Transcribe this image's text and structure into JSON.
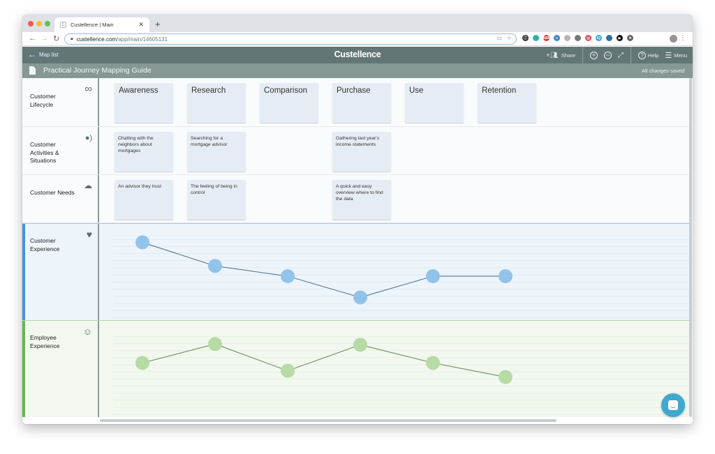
{
  "browser": {
    "tab_title": "Custellence | Main",
    "tab_favicon": "C",
    "url_domain": "custellence.com",
    "url_path": "/app/main/14605131",
    "extensions": [
      {
        "name": "1password-icon",
        "color": "#333333",
        "glyph": "ⓘ"
      },
      {
        "name": "teal-extension-icon",
        "color": "#2bb3a8",
        "glyph": ""
      },
      {
        "name": "adblock-icon",
        "color": "#d63a3a",
        "glyph": "ABP"
      },
      {
        "name": "link-extension-icon",
        "color": "#4a7fc8",
        "glyph": "∞"
      },
      {
        "name": "grey-extension-icon",
        "color": "#b5b5b5",
        "glyph": ""
      },
      {
        "name": "dark-grey-extension-icon",
        "color": "#777777",
        "glyph": ""
      },
      {
        "name": "target-extension-icon",
        "color": "#e8505b",
        "glyph": "◎"
      },
      {
        "name": "iq-extension-icon",
        "color": "#3aa0e0",
        "glyph": "IQ"
      },
      {
        "name": "blue-circle-extension-icon",
        "color": "#2a6fa8",
        "glyph": ""
      },
      {
        "name": "play-extension-icon",
        "color": "#111111",
        "glyph": "▶"
      },
      {
        "name": "screenshot-extension-icon",
        "color": "#666666",
        "glyph": "⌗"
      }
    ]
  },
  "app": {
    "back_label": "Map list",
    "brand": "Custellence",
    "share_label": "Share",
    "help_label": "Help",
    "menu_label": "Menu",
    "doc_title": "Practical Journey Mapping Guide",
    "save_status": "All changes saved"
  },
  "lanes": {
    "lifecycle": {
      "label": "Customer Lifecycle",
      "icon": "infinity-icon"
    },
    "activities": {
      "label": "Customer Activities & Situations",
      "icon": "person-speaking-icon"
    },
    "needs": {
      "label": "Customer Needs",
      "icon": "thought-bubble-icon"
    },
    "cx": {
      "label": "Customer Experience",
      "icon": "heart-icon"
    },
    "ex": {
      "label": "Employee Experience",
      "icon": "employee-face-icon"
    }
  },
  "stages": [
    "Awareness",
    "Research",
    "Comparison",
    "Purchase",
    "Use",
    "Retention"
  ],
  "activities": [
    "Chatting with the neighbors about mortgages",
    "Searching for a mortgage advisor",
    "",
    "Gathering last year's income statements",
    "",
    ""
  ],
  "needs": [
    "An advisor they trust",
    "The feeling of being in control",
    "",
    "A quick and easy overview where to find the data",
    "",
    ""
  ],
  "chart_data": [
    {
      "type": "line",
      "title": "Customer Experience",
      "categories": [
        "Awareness",
        "Research",
        "Comparison",
        "Purchase",
        "Use",
        "Retention"
      ],
      "values": [
        9,
        6,
        4.7,
        2,
        4.7,
        4.7
      ],
      "ylim": [
        0,
        11
      ],
      "point_color": "#92c3ea",
      "line_color": "#4f7b94"
    },
    {
      "type": "line",
      "title": "Employee Experience",
      "categories": [
        "Awareness",
        "Research",
        "Comparison",
        "Purchase",
        "Use",
        "Retention"
      ],
      "values": [
        6,
        8.4,
        5,
        8.3,
        6,
        4.2
      ],
      "ylim": [
        0,
        11
      ],
      "point_color": "#b6dba5",
      "line_color": "#6f8f5f"
    }
  ]
}
